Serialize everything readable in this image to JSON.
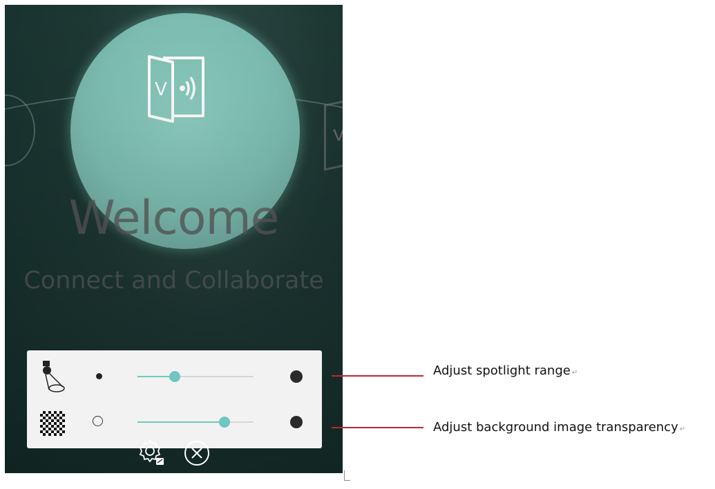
{
  "screen": {
    "welcome_title": "Welcome",
    "tagline": "Connect and Collaborate",
    "app_icon_letter": "V",
    "side_icon_letter": "V"
  },
  "panel": {
    "spotlight_range": {
      "icon": "spotlight-icon",
      "min_icon": "small-dot-icon",
      "max_icon": "large-dot-icon",
      "value_fraction": 0.32
    },
    "background_transparency": {
      "icon": "checkerboard-icon",
      "min_icon": "empty-circle-icon",
      "max_icon": "large-dot-icon",
      "value_fraction": 0.75
    }
  },
  "controls": {
    "settings_icon": "gear-icon",
    "close_icon": "close-circle-icon"
  },
  "annotations": {
    "spotlight_label": "Adjust spotlight range",
    "transparency_label": "Adjust background image transparency",
    "paragraph_mark": "↵",
    "line_color": "#c0272d"
  },
  "colors": {
    "accent": "#6fc7bf",
    "spotlight": "#8fcfc2",
    "background": "#1d3733",
    "panel": "#f2f2f2"
  }
}
